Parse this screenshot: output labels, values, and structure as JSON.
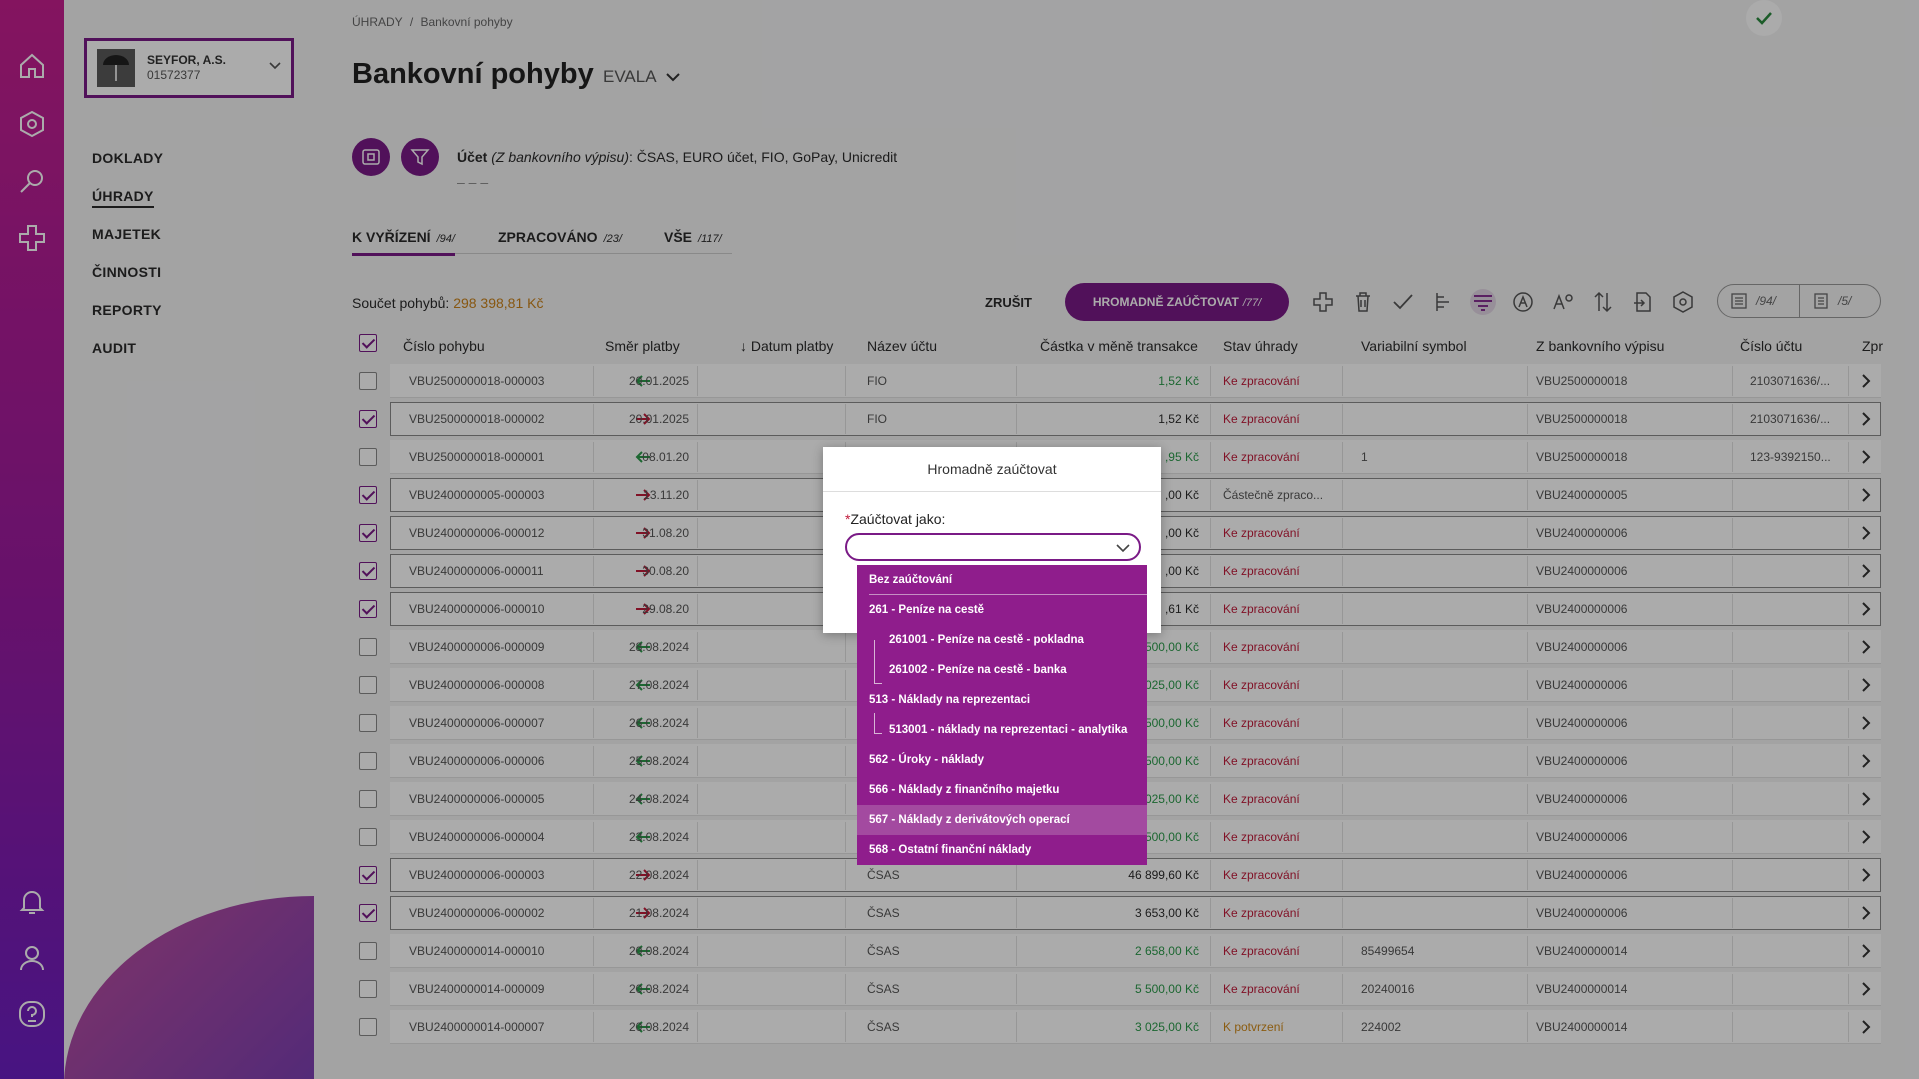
{
  "rail": {
    "icons": [
      "home-icon",
      "hexagon-icon",
      "search-icon",
      "plus-cross-icon",
      "bell-icon",
      "user-icon",
      "help-icon"
    ]
  },
  "company": {
    "name": "SEYFOR, A.S.",
    "ico": "01572377"
  },
  "nav": {
    "items": [
      "DOKLADY",
      "ÚHRADY",
      "MAJETEK",
      "ČINNOSTI",
      "REPORTY",
      "AUDIT"
    ],
    "active": "ÚHRADY"
  },
  "breadcrumb": {
    "root": "ÚHRADY",
    "sep": "/",
    "current": "Bankovní pohyby"
  },
  "page": {
    "title": "Bankovní pohyby",
    "context": "EVALA"
  },
  "filter": {
    "label": "Účet",
    "label_note": "(Z bankovního výpisu)",
    "value": ": ČSAS, EURO účet, FIO, GoPay, Unicredit",
    "sub": "– – –"
  },
  "tabs": [
    {
      "label": "K VYŘÍZENÍ",
      "count": "/94/"
    },
    {
      "label": "ZPRACOVÁNO",
      "count": "/23/"
    },
    {
      "label": "VŠE",
      "count": "/117/"
    }
  ],
  "summary": {
    "label": "Součet pohybů:",
    "value": "298 398,81 Kč"
  },
  "actions": {
    "cancel": "ZRUŠIT",
    "bulk": "HROMADNĚ ZAÚČTOVAT",
    "bulk_count": "/77/"
  },
  "segment": {
    "left": "/94/",
    "right": "/5/"
  },
  "table": {
    "columns": [
      "Číslo pohybu",
      "Směr platby",
      "↓ Datum platby",
      "Název účtu",
      "Částka v měně transakce",
      "Stav úhrady",
      "Variabilní symbol",
      "Z bankovního výpisu",
      "Číslo účtu",
      "Zpr"
    ],
    "rows": [
      {
        "checked": false,
        "id": "VBU2500000018-000003",
        "dir": "in",
        "date": "20.01.2025",
        "account": "FIO",
        "amount": "1,52 Kč",
        "status": "Ke zpracování",
        "vs": "",
        "statement": "VBU2500000018",
        "acct_no": "2103071636/..."
      },
      {
        "checked": true,
        "id": "VBU2500000018-000002",
        "dir": "out",
        "date": "20.01.2025",
        "account": "FIO",
        "amount": "1,52 Kč",
        "status": "Ke zpracování",
        "vs": "",
        "statement": "VBU2500000018",
        "acct_no": "2103071636/..."
      },
      {
        "checked": false,
        "id": "VBU2500000018-000001",
        "dir": "in",
        "date": "08.01.20",
        "account": "",
        "amount": ",95 Kč",
        "status": "Ke zpracování",
        "vs": "1",
        "statement": "VBU2500000018",
        "acct_no": "123-9392150..."
      },
      {
        "checked": true,
        "id": "VBU2400000005-000003",
        "dir": "out",
        "date": "13.11.20",
        "account": "",
        "amount": ",00 Kč",
        "status": "Částečně zpraco...",
        "vs": "",
        "statement": "VBU2400000005",
        "acct_no": ""
      },
      {
        "checked": true,
        "id": "VBU2400000006-000012",
        "dir": "out",
        "date": "31.08.20",
        "account": "",
        "amount": ",00 Kč",
        "status": "Ke zpracování",
        "vs": "",
        "statement": "VBU2400000006",
        "acct_no": ""
      },
      {
        "checked": true,
        "id": "VBU2400000006-000011",
        "dir": "out",
        "date": "30.08.20",
        "account": "",
        "amount": ",00 Kč",
        "status": "Ke zpracování",
        "vs": "",
        "statement": "VBU2400000006",
        "acct_no": ""
      },
      {
        "checked": true,
        "id": "VBU2400000006-000010",
        "dir": "out",
        "date": "29.08.20",
        "account": "",
        "amount": ",61 Kč",
        "status": "Ke zpracování",
        "vs": "",
        "statement": "VBU2400000006",
        "acct_no": ""
      },
      {
        "checked": false,
        "id": "VBU2400000006-000009",
        "dir": "in",
        "date": "28.08.2024",
        "account": "",
        "amount": "500,00 Kč",
        "status": "Ke zpracování",
        "vs": "",
        "statement": "VBU2400000006",
        "acct_no": ""
      },
      {
        "checked": false,
        "id": "VBU2400000006-000008",
        "dir": "in",
        "date": "27.08.2024",
        "account": "",
        "amount": "025,00 Kč",
        "status": "Ke zpracování",
        "vs": "",
        "statement": "VBU2400000006",
        "acct_no": ""
      },
      {
        "checked": false,
        "id": "VBU2400000006-000007",
        "dir": "in",
        "date": "26.08.2024",
        "account": "",
        "amount": "500,00 Kč",
        "status": "Ke zpracování",
        "vs": "",
        "statement": "VBU2400000006",
        "acct_no": ""
      },
      {
        "checked": false,
        "id": "VBU2400000006-000006",
        "dir": "in",
        "date": "25.08.2024",
        "account": "",
        "amount": "500,00 Kč",
        "status": "Ke zpracování",
        "vs": "",
        "statement": "VBU2400000006",
        "acct_no": ""
      },
      {
        "checked": false,
        "id": "VBU2400000006-000005",
        "dir": "in",
        "date": "24.08.2024",
        "account": "",
        "amount": "025,00 Kč",
        "status": "Ke zpracování",
        "vs": "",
        "statement": "VBU2400000006",
        "acct_no": ""
      },
      {
        "checked": false,
        "id": "VBU2400000006-000004",
        "dir": "in",
        "date": "23.08.2024",
        "account": "",
        "amount": "500,00 Kč",
        "status": "Ke zpracování",
        "vs": "",
        "statement": "VBU2400000006",
        "acct_no": ""
      },
      {
        "checked": true,
        "id": "VBU2400000006-000003",
        "dir": "out",
        "date": "22.08.2024",
        "account": "ČSAS",
        "amount": "46 899,60 Kč",
        "status": "Ke zpracování",
        "vs": "",
        "statement": "VBU2400000006",
        "acct_no": ""
      },
      {
        "checked": true,
        "id": "VBU2400000006-000002",
        "dir": "out",
        "date": "21.08.2024",
        "account": "ČSAS",
        "amount": "3 653,00 Kč",
        "status": "Ke zpracování",
        "vs": "",
        "statement": "VBU2400000006",
        "acct_no": ""
      },
      {
        "checked": false,
        "id": "VBU2400000014-000010",
        "dir": "in",
        "date": "20.08.2024",
        "account": "ČSAS",
        "amount": "2 658,00 Kč",
        "status": "Ke zpracování",
        "vs": "85499654",
        "statement": "VBU2400000014",
        "acct_no": ""
      },
      {
        "checked": false,
        "id": "VBU2400000014-000009",
        "dir": "in",
        "date": "20.08.2024",
        "account": "ČSAS",
        "amount": "5 500,00 Kč",
        "status": "Ke zpracování",
        "vs": "20240016",
        "statement": "VBU2400000014",
        "acct_no": ""
      },
      {
        "checked": false,
        "id": "VBU2400000014-000007",
        "dir": "in",
        "date": "20.08.2024",
        "account": "ČSAS",
        "amount": "3 025,00 Kč",
        "status": "K potvrzení",
        "vs": "224002",
        "statement": "VBU2400000014",
        "acct_no": ""
      }
    ]
  },
  "modal": {
    "title": "Hromadně zaúčtovat",
    "field_label": "Zaúčtovat jako:",
    "required_mark": "*",
    "select_value": "",
    "options": [
      {
        "label": "Bez zaúčtování",
        "level": 0
      },
      {
        "label": "261 - Peníze na cestě",
        "level": 0
      },
      {
        "label": "261001 - Peníze na cestě - pokladna",
        "level": 1
      },
      {
        "label": "261002 - Peníze na cestě - banka",
        "level": 1
      },
      {
        "label": "513 - Náklady na reprezentaci",
        "level": 0
      },
      {
        "label": "513001 - náklady na reprezentaci - analytika",
        "level": 1
      },
      {
        "label": "562 - Úroky - náklady",
        "level": 0
      },
      {
        "label": "566 - Náklady z finančního majetku",
        "level": 0
      },
      {
        "label": "567 - Náklady z derivátových operací",
        "level": 0
      },
      {
        "label": "568 - Ostatní finanční náklady",
        "level": 0
      }
    ],
    "highlighted": "567 - Náklady z derivátových operací"
  },
  "colors": {
    "brand": "#7a1a86",
    "positive": "#2a9a4a",
    "negative": "#c01a3a",
    "warning": "#d08a1a"
  }
}
